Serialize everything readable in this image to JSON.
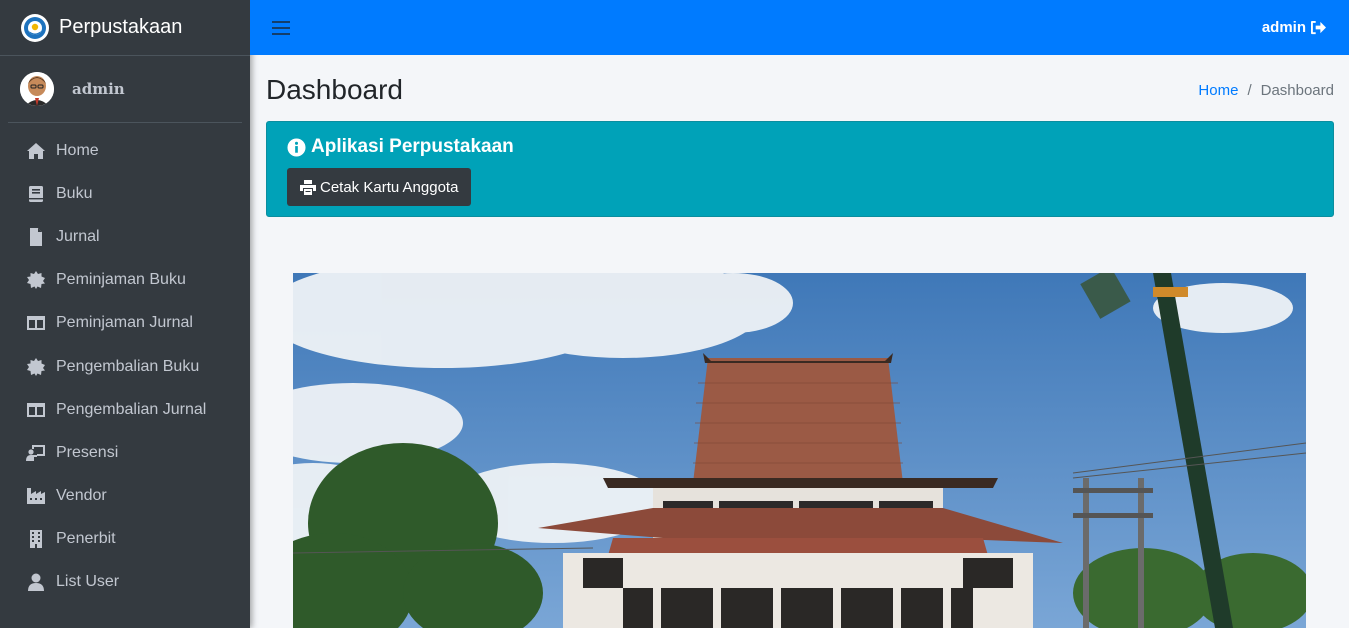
{
  "brand": {
    "name": "Perpustakaan",
    "icon": "tut-wuri-logo-icon"
  },
  "user_panel": {
    "name": "admin",
    "avatar": "user-avatar-icon"
  },
  "sidebar": {
    "items": [
      {
        "label": "Home",
        "icon": "home-icon"
      },
      {
        "label": "Buku",
        "icon": "book-icon"
      },
      {
        "label": "Jurnal",
        "icon": "file-icon"
      },
      {
        "label": "Peminjaman Buku",
        "icon": "gear-icon"
      },
      {
        "label": "Peminjaman Jurnal",
        "icon": "columns-icon"
      },
      {
        "label": "Pengembalian Buku",
        "icon": "gear-icon"
      },
      {
        "label": "Pengembalian Jurnal",
        "icon": "columns-icon"
      },
      {
        "label": "Presensi",
        "icon": "chalkboard-teacher-icon"
      },
      {
        "label": "Vendor",
        "icon": "industry-icon"
      },
      {
        "label": "Penerbit",
        "icon": "building-icon"
      },
      {
        "label": "List User",
        "icon": "user-icon"
      }
    ]
  },
  "header": {
    "user_label": "admin",
    "logout_icon": "sign-out-icon",
    "toggle_icon": "hamburger-menu-icon"
  },
  "content": {
    "title": "Dashboard",
    "breadcrumb": {
      "home": "Home",
      "separator": "/",
      "current": "Dashboard"
    }
  },
  "callout": {
    "title": "Aplikasi Perpustakaan",
    "title_icon": "info-circle-icon",
    "button_label": "Cetak Kartu Anggota",
    "button_icon": "print-icon"
  },
  "colors": {
    "sidebar": "#343a40",
    "header": "#007bff",
    "callout": "#00a2b8",
    "button": "#343a40",
    "link": "#007bff"
  }
}
